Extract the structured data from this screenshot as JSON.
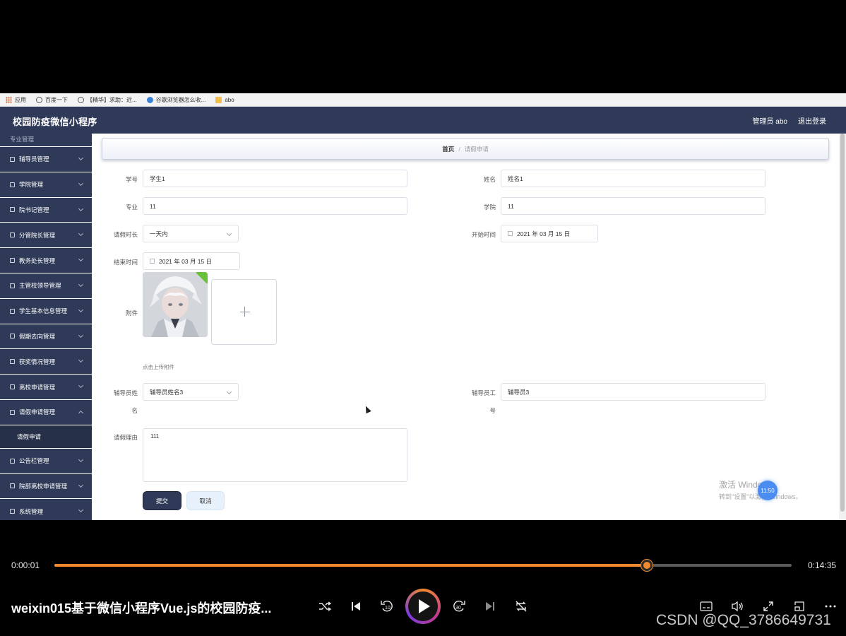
{
  "bookmarks": [
    {
      "label": "应用",
      "icon": "apps-grid-icon"
    },
    {
      "label": "百度一下",
      "icon": "globe-icon"
    },
    {
      "label": "【精华】求助：近...",
      "icon": "globe-icon"
    },
    {
      "label": "谷歌浏览器怎么收...",
      "icon": "flower-icon"
    },
    {
      "label": "abo",
      "icon": "folder-icon"
    }
  ],
  "header": {
    "title": "校园防疫微信小程序",
    "admin": "管理员 abo",
    "logout": "退出登录"
  },
  "sidebar": {
    "partial_item": "专业管理",
    "items": [
      {
        "label": "辅导员管理",
        "icon": "briefcase-icon"
      },
      {
        "label": "学院管理",
        "icon": "building-icon"
      },
      {
        "label": "院书记管理",
        "icon": "picture-icon"
      },
      {
        "label": "分管院长管理",
        "icon": "send-icon"
      },
      {
        "label": "教务处长管理",
        "icon": "chat-icon"
      },
      {
        "label": "主管校领导管理",
        "icon": "notebook-icon"
      },
      {
        "label": "学生基本信息管理",
        "icon": "crop-icon"
      },
      {
        "label": "假期去向管理",
        "icon": "sliders-icon"
      },
      {
        "label": "获奖情况管理",
        "icon": "paper-plane-icon"
      },
      {
        "label": "离校申请管理",
        "icon": "document-icon"
      },
      {
        "label": "请假申请管理",
        "icon": "grid-icon",
        "expanded": true
      }
    ],
    "sub_item": "请假申请",
    "items_after": [
      {
        "label": "公告栏管理",
        "icon": "clipboard-icon"
      },
      {
        "label": "院部离校申请管理",
        "icon": "power-icon"
      },
      {
        "label": "系统管理",
        "icon": "location-icon"
      }
    ]
  },
  "breadcrumb": {
    "home": "首页",
    "separator": "/",
    "current": "请假申请"
  },
  "form": {
    "student_id_label": "学号",
    "student_id_value": "学生1",
    "name_label": "姓名",
    "name_value": "姓名1",
    "major_label": "专业",
    "major_value": "11",
    "college_label": "学院",
    "college_value": "11",
    "duration_label": "请假时长",
    "duration_value": "一天内",
    "start_label": "开始时间",
    "start_value": "2021 年 03 月 15 日",
    "end_label": "结束时间",
    "end_value": "2021 年 03 月 15 日",
    "attachment_label": "附件",
    "attachment_hint": "点击上传附件",
    "counselor_name_label_1": "辅导员姓",
    "counselor_name_label_2": "名",
    "counselor_name_value": "辅导员姓名3",
    "counselor_no_label_1": "辅导员工",
    "counselor_no_label_2": "号",
    "counselor_no_value": "辅导员3",
    "reason_label": "请假理由",
    "reason_value": "111",
    "submit": "提交",
    "cancel": "取消"
  },
  "watermark": {
    "line1": "激活 Windows",
    "line2": "转到\"设置\"以激活 Windows。",
    "badge": "11:50"
  },
  "player": {
    "current_time": "0:00:01",
    "total_time": "0:14:35",
    "progress": 0.804,
    "title": "weixin015基于微信小程序Vue.js的校园防疫...",
    "accent": "#f08a2c",
    "credit": "CSDN @QQ_3786649731"
  }
}
